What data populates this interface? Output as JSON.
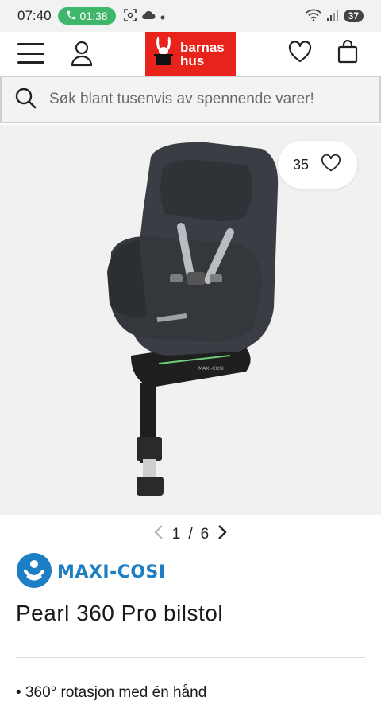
{
  "status_bar": {
    "time": "07:40",
    "call_duration": "01:38",
    "battery": "37"
  },
  "header": {
    "logo_line1": "barnas",
    "logo_line2": "hus",
    "brand_color": "#e8231b"
  },
  "search": {
    "placeholder": "Søk blant tusenvis av spennende varer!"
  },
  "product": {
    "favorite_count": "35",
    "image_index": "1",
    "image_separator": "/",
    "image_total": "6",
    "brand": "MAXI-COSI",
    "title": "Pearl 360 Pro bilstol",
    "bullets": [
      "• 360° rotasjon med én hånd"
    ]
  },
  "colors": {
    "brand_blue": "#1d7ec4",
    "call_green": "#3fb76b"
  }
}
